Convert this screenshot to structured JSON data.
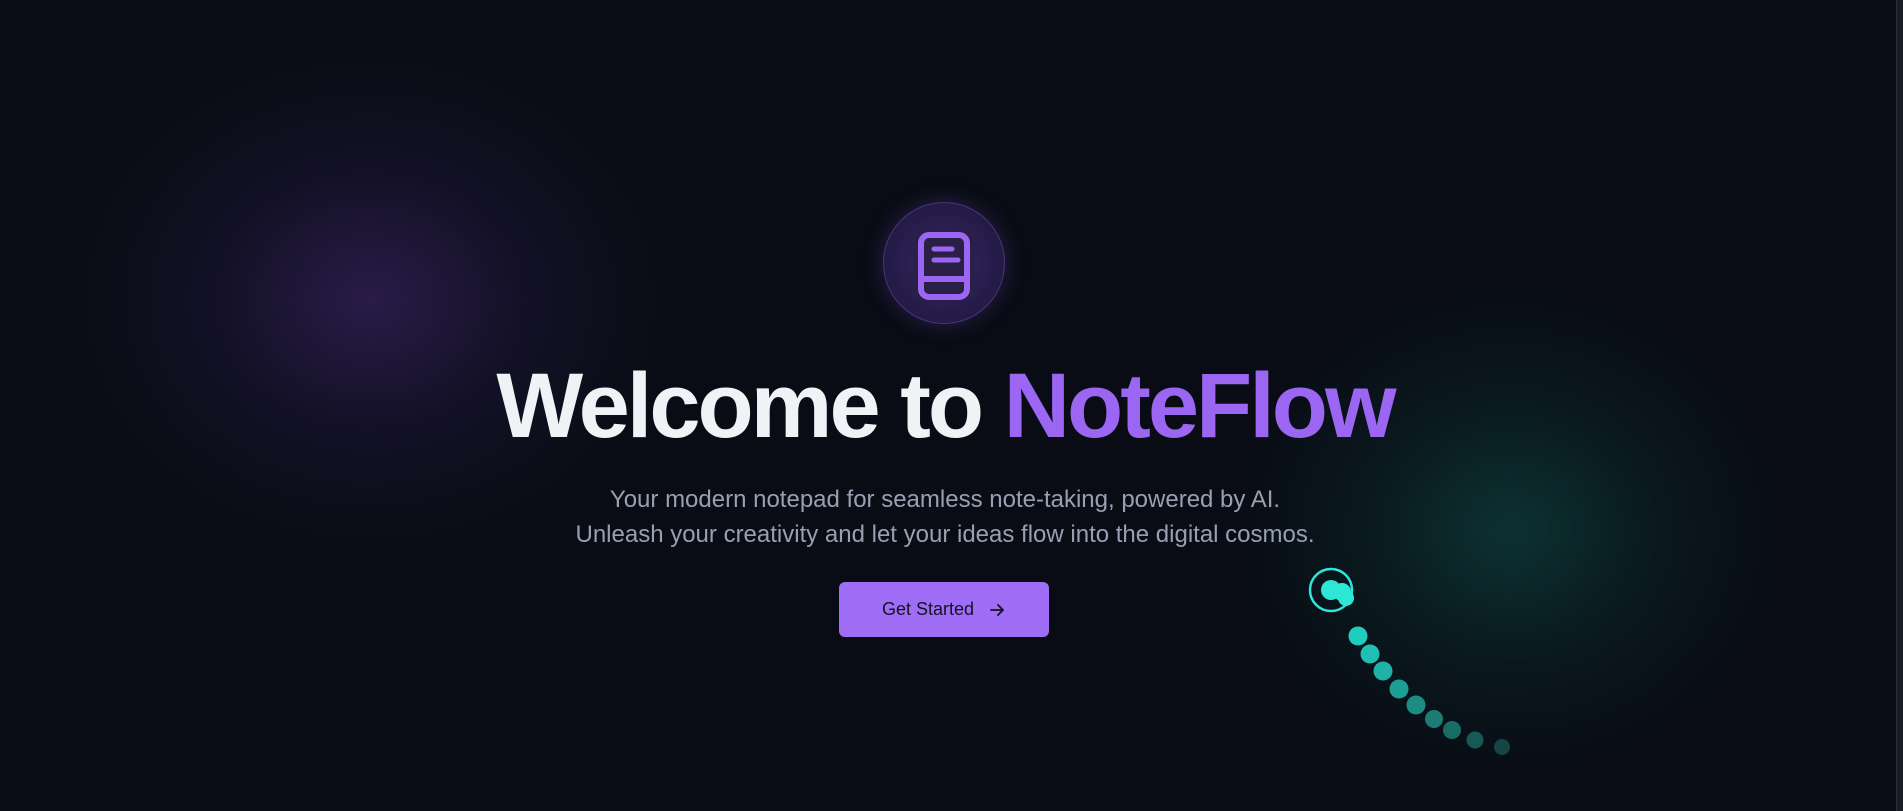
{
  "hero": {
    "logo_icon": "book-icon",
    "headline_lead": "Welcome to ",
    "headline_brand": "NoteFlow",
    "subtitle_line1": "Your modern notepad for seamless note-taking, powered by AI.",
    "subtitle_line2": "Unleash your creativity and let your ideas flow into the digital cosmos.",
    "cta_label": "Get Started",
    "cta_icon": "arrow-right-icon"
  },
  "colors": {
    "background": "#090c14",
    "accent_purple": "#9b66f2",
    "button": "#9f6df6",
    "teal": "#22d3c5",
    "subtitle": "#97a0b3"
  }
}
